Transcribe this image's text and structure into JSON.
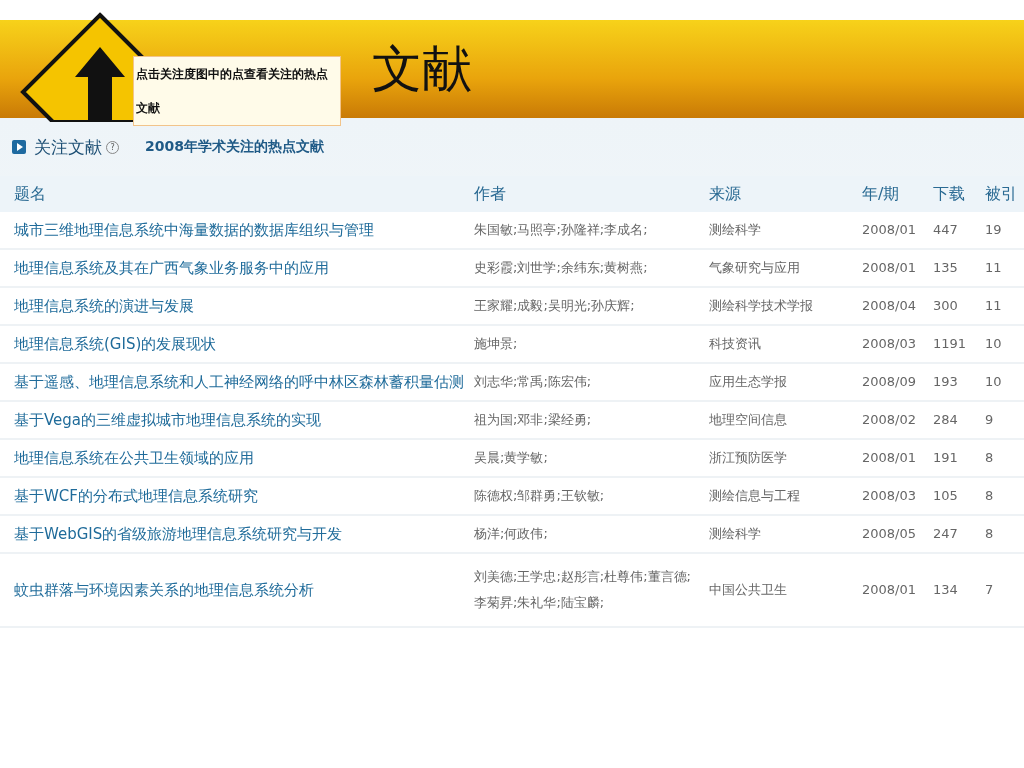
{
  "slide": {
    "title": "文献"
  },
  "tooltip": {
    "text": "点击关注度图中的点查看关注的热点文献"
  },
  "section": {
    "heading": "关注文献",
    "help": "?",
    "subtitle": "2008年学术关注的热点文献"
  },
  "table": {
    "columns": [
      "题名",
      "作者",
      "来源",
      "年/期",
      "下载",
      "被引"
    ],
    "rows": [
      {
        "title": "城市三维地理信息系统中海量数据的数据库组织与管理",
        "authors": "朱国敏;马照亭;孙隆祥;李成名;",
        "source": "测绘科学",
        "issue": "2008/01",
        "downloads": "447",
        "cited": "19"
      },
      {
        "title": "地理信息系统及其在广西气象业务服务中的应用",
        "authors": "史彩霞;刘世学;余纬东;黄树燕;",
        "source": "气象研究与应用",
        "issue": "2008/01",
        "downloads": "135",
        "cited": "11"
      },
      {
        "title": "地理信息系统的演进与发展",
        "authors": "王家耀;成毅;吴明光;孙庆辉;",
        "source": "测绘科学技术学报",
        "issue": "2008/04",
        "downloads": "300",
        "cited": "11"
      },
      {
        "title": "地理信息系统(GIS)的发展现状",
        "authors": "施坤景;",
        "source": "科技资讯",
        "issue": "2008/03",
        "downloads": "1191",
        "cited": "10"
      },
      {
        "title": "基于遥感、地理信息系统和人工神经网络的呼中林区森林蓄积量估测",
        "authors": "刘志华;常禹;陈宏伟;",
        "source": "应用生态学报",
        "issue": "2008/09",
        "downloads": "193",
        "cited": "10"
      },
      {
        "title": "基于Vega的三维虚拟城市地理信息系统的实现",
        "authors": "祖为国;邓非;梁经勇;",
        "source": "地理空间信息",
        "issue": "2008/02",
        "downloads": "284",
        "cited": "9"
      },
      {
        "title": "地理信息系统在公共卫生领域的应用",
        "authors": "吴晨;黄学敏;",
        "source": "浙江预防医学",
        "issue": "2008/01",
        "downloads": "191",
        "cited": "8"
      },
      {
        "title": "基于WCF的分布式地理信息系统研究",
        "authors": "陈德权;邹群勇;王钦敏;",
        "source": "测绘信息与工程",
        "issue": "2008/03",
        "downloads": "105",
        "cited": "8"
      },
      {
        "title": "基于WebGIS的省级旅游地理信息系统研究与开发",
        "authors": "杨洋;何政伟;",
        "source": "测绘科学",
        "issue": "2008/05",
        "downloads": "247",
        "cited": "8"
      },
      {
        "title": "蚊虫群落与环境因素关系的地理信息系统分析",
        "authors": "刘美德;王学忠;赵彤言;杜尊伟;董言德;李菊昇;朱礼华;陆宝麟;",
        "source": "中国公共卫生",
        "issue": "2008/01",
        "downloads": "134",
        "cited": "7"
      }
    ]
  }
}
